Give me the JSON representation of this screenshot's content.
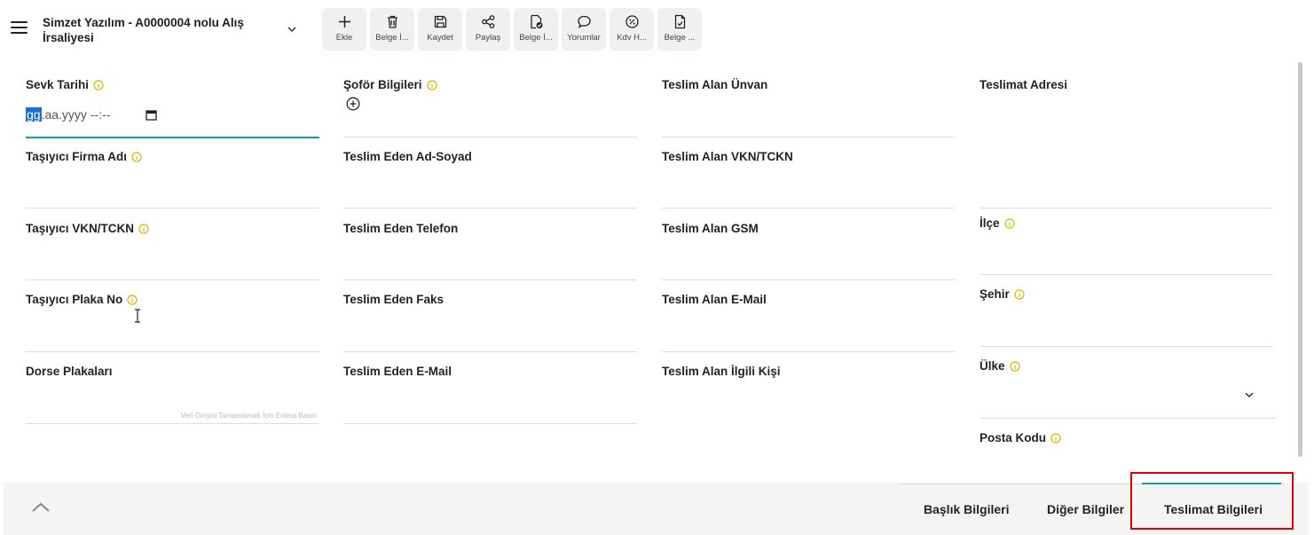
{
  "header": {
    "title": "Simzet Yazılım - A0000004 nolu Alış İrsaliyesi",
    "toolbar": [
      {
        "label": "Ekle",
        "icon": "plus-icon"
      },
      {
        "label": "Belge İ...",
        "icon": "trash-icon"
      },
      {
        "label": "Kaydet",
        "icon": "save-icon"
      },
      {
        "label": "Paylaş",
        "icon": "share-icon"
      },
      {
        "label": "Belge İ...",
        "icon": "document-check-icon"
      },
      {
        "label": "Yorumlar",
        "icon": "comment-icon"
      },
      {
        "label": "Kdv H...",
        "icon": "percent-icon"
      },
      {
        "label": "Belge ...",
        "icon": "document-icon"
      }
    ]
  },
  "form": {
    "col1": {
      "sevk_tarihi": {
        "label": "Sevk Tarihi",
        "value_sel": "gg",
        "value_rest": ".aa.yyyy --:--"
      },
      "tasiyici_firma": {
        "label": "Taşıyıcı Firma Adı"
      },
      "tasiyici_vkn": {
        "label": "Taşıyıcı VKN/TCKN"
      },
      "tasiyici_plaka": {
        "label": "Taşıyıcı Plaka No"
      },
      "dorse": {
        "label": "Dorse Plakaları",
        "hint": "Veri Girişini Tamamlamak İçin Entera Basın"
      }
    },
    "col2": {
      "sofor": {
        "label": "Şoför Bilgileri"
      },
      "teslim_eden_ad": {
        "label": "Teslim Eden Ad-Soyad"
      },
      "teslim_eden_tel": {
        "label": "Teslim Eden Telefon"
      },
      "teslim_eden_faks": {
        "label": "Teslim Eden Faks"
      },
      "teslim_eden_mail": {
        "label": "Teslim Eden E-Mail"
      }
    },
    "col3": {
      "teslim_alan_unvan": {
        "label": "Teslim Alan Ünvan"
      },
      "teslim_alan_vkn": {
        "label": "Teslim Alan VKN/TCKN"
      },
      "teslim_alan_gsm": {
        "label": "Teslim Alan GSM"
      },
      "teslim_alan_mail": {
        "label": "Teslim Alan E-Mail"
      },
      "teslim_alan_ilgili": {
        "label": "Teslim Alan İlgili Kişi"
      }
    },
    "col4": {
      "teslimat_adresi": {
        "label": "Teslimat Adresi"
      },
      "ilce": {
        "label": "İlçe"
      },
      "sehir": {
        "label": "Şehir"
      },
      "ulke": {
        "label": "Ülke"
      },
      "posta_kodu": {
        "label": "Posta Kodu"
      }
    }
  },
  "footer": {
    "tabs": [
      {
        "label": "Başlık Bilgileri"
      },
      {
        "label": "Diğer Bilgiler"
      },
      {
        "label": "Teslimat Bilgileri",
        "active": true
      }
    ]
  },
  "colors": {
    "accent": "#1a9a9a",
    "info": "#d4b800",
    "highlight": "#e00000"
  }
}
